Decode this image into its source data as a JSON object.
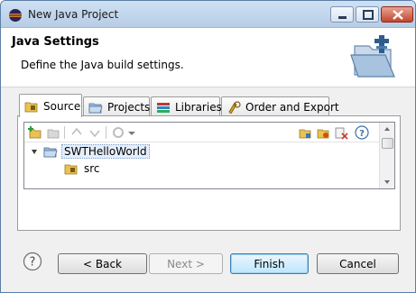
{
  "window": {
    "title": "New Java Project"
  },
  "banner": {
    "title": "Java Settings",
    "description": "Define the Java build settings."
  },
  "tabs": [
    {
      "label": "Source",
      "icon": "source-folder-icon",
      "active": true
    },
    {
      "label": "Projects",
      "icon": "projects-icon",
      "active": false
    },
    {
      "label": "Libraries",
      "icon": "libraries-icon",
      "active": false
    },
    {
      "label": "Order and Export",
      "icon": "order-export-icon",
      "active": false
    }
  ],
  "tree": {
    "items": [
      {
        "label": "SWTHelloWorld",
        "icon": "project-folder-icon",
        "expanded": true,
        "selected": true
      },
      {
        "label": "src",
        "icon": "source-folder-icon"
      }
    ]
  },
  "footer": {
    "back": "< Back",
    "next": "Next >",
    "finish": "Finish",
    "cancel": "Cancel"
  },
  "colors": {
    "accent": "#3c7fb1",
    "selection": "#e5eefc",
    "folder": "#e9c253"
  }
}
